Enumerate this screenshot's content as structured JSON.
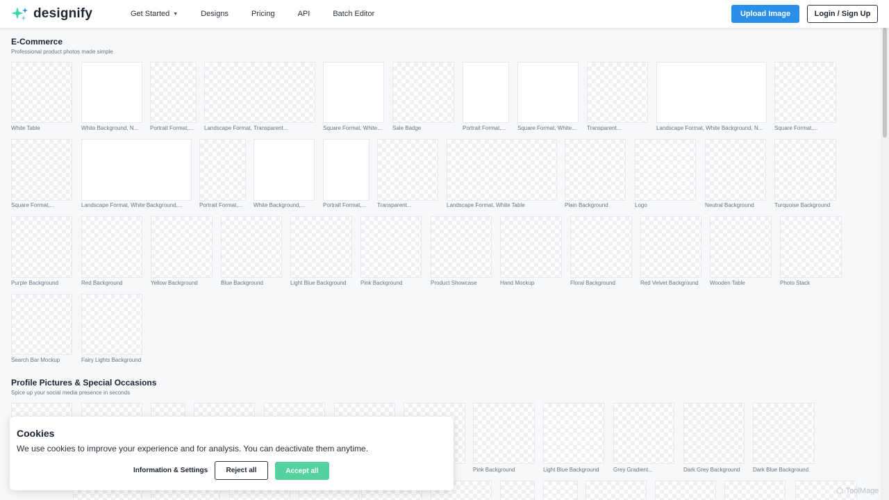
{
  "brand": {
    "name": "designify",
    "accent": "#2a8fe8",
    "logo_colors": [
      "#3ad6a8",
      "#2a8fe8"
    ]
  },
  "nav": {
    "items": [
      "Get Started",
      "Designs",
      "Pricing",
      "API",
      "Batch Editor"
    ],
    "upload_label": "Upload Image",
    "login_label": "Login / Sign Up"
  },
  "sections": {
    "ecommerce": {
      "title": "E-Commerce",
      "subtitle": "Professional product photos made simple",
      "items": [
        "White Table",
        "White Background, N...",
        "Portrait Format,...",
        "Landscape Format, Transparent...",
        "Square Format, White...",
        "Sale Badge",
        "Portrait Format,...",
        "Square Format, White...",
        "Transparent...",
        "Landscape Format, White Background, N...",
        "Square Format,...",
        "Square Format,...",
        "Landscape Format, White Background,...",
        "Portrait Format,...",
        "White Background,...",
        "Portrait Format,...",
        "Transparent...",
        "Landscape Format, White Table",
        "Plain Background",
        "Logo",
        "Neutral Background",
        "Turquoise Background",
        "Purple Background",
        "Red Background",
        "Yellow Background",
        "Blue Background",
        "Light Blue Background",
        "Pink Background",
        "Product Showcase",
        "Hand Mockup",
        "Floral Background",
        "Red Velvet Background",
        "Wooden Table",
        "Photo Stack",
        "Search Bar Mockup",
        "Fairy Lights Background"
      ]
    },
    "profile": {
      "title": "Profile Pictures & Special Occasions",
      "subtitle": "Spice up your social media presence in seconds",
      "items": [
        "Pink Background",
        "Light Blue Background",
        "Grey Gradient...",
        "Dark Grey Background",
        "Dark Blue Background"
      ]
    }
  },
  "cookie": {
    "title": "Cookies",
    "text": "We use cookies to improve your experience and for analysis. You can deactivate them anytime.",
    "info_label": "Information & Settings",
    "reject_label": "Reject all",
    "accept_label": "Accept all",
    "accept_color": "#53d19e"
  },
  "watermark": "ToolMage"
}
